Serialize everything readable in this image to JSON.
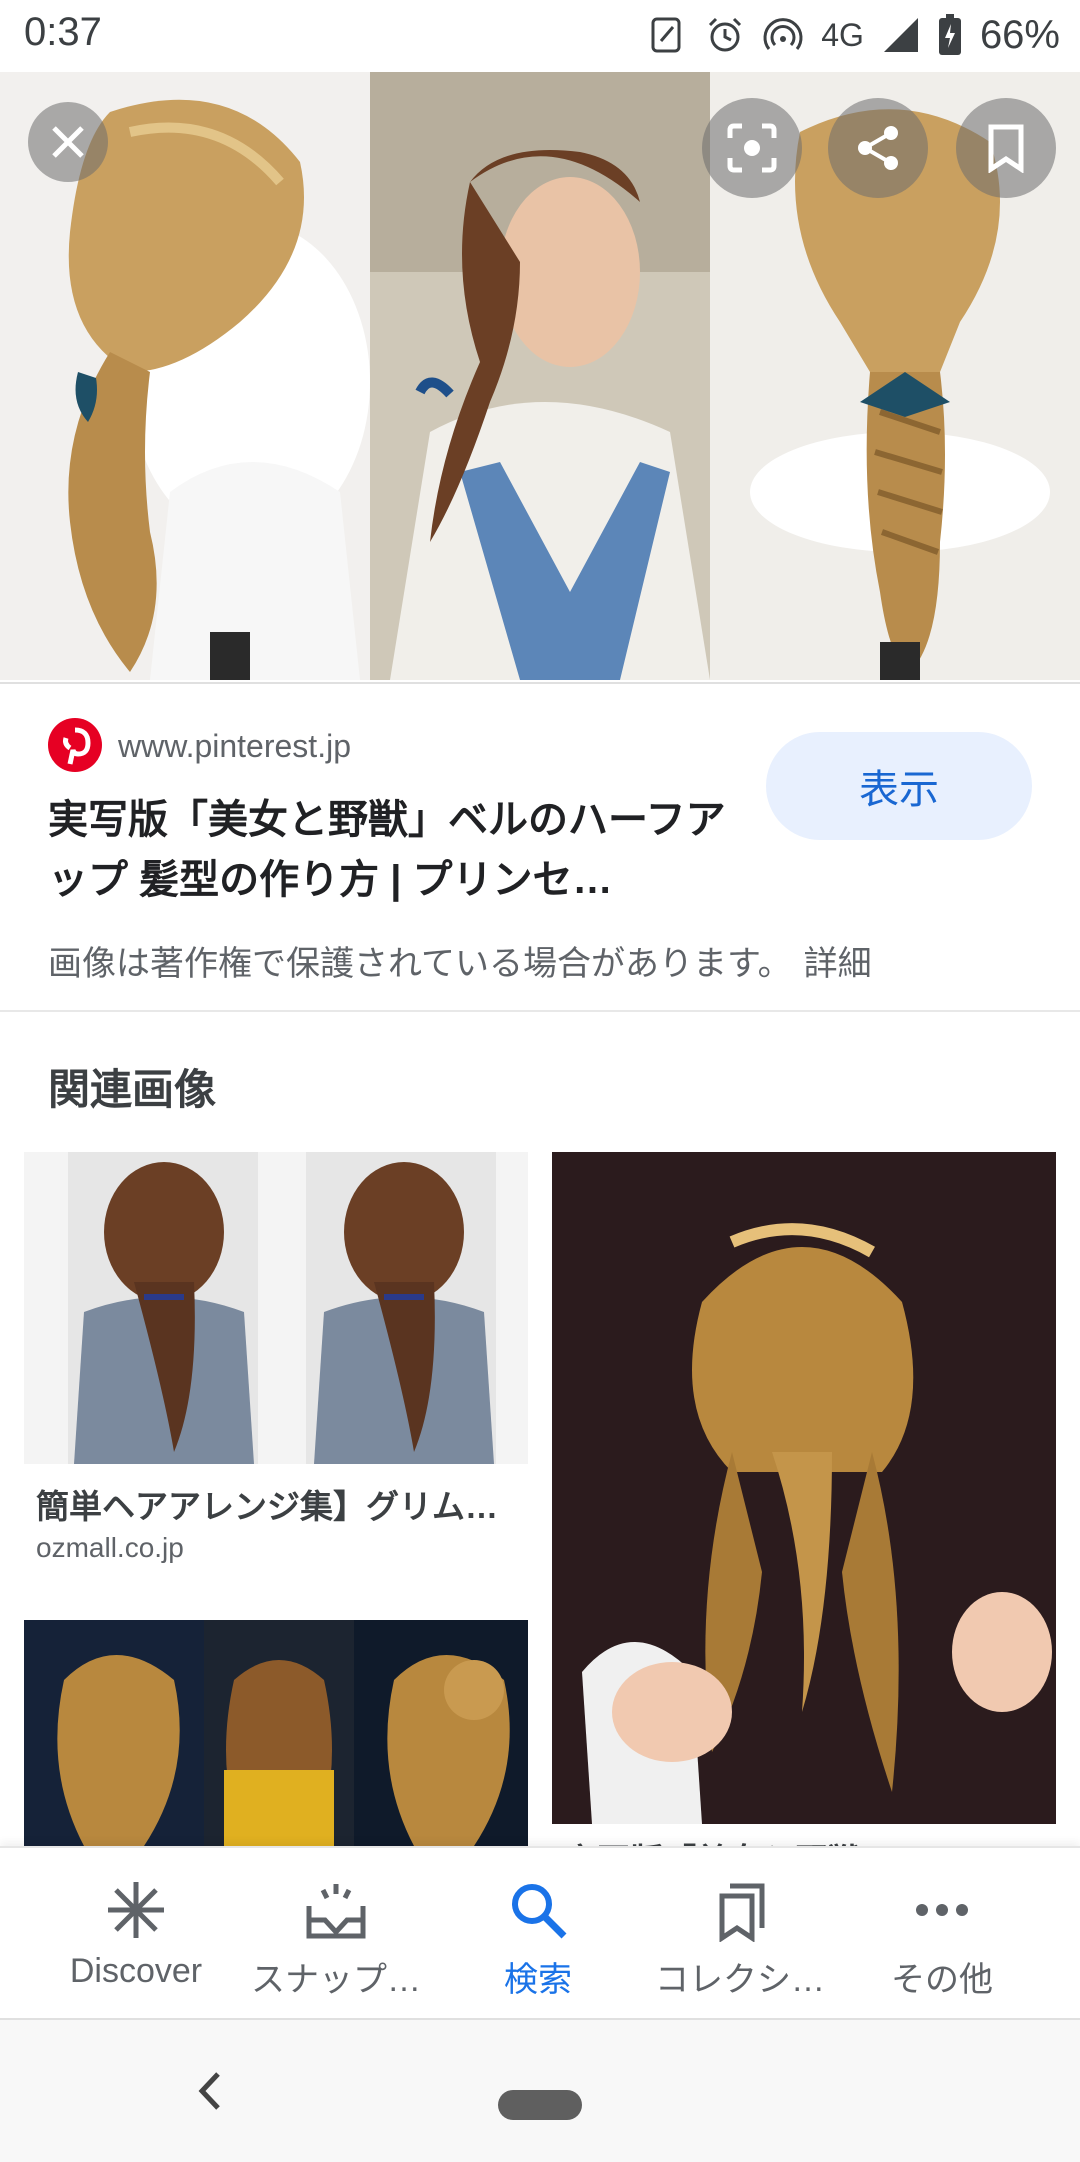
{
  "status_bar": {
    "time": "0:37",
    "network": "4G",
    "battery": "66%"
  },
  "result": {
    "domain": "www.pinterest.jp",
    "title": "実写版「美女と野獣」ベルのハーフアップ 髪型の作り方 | プリンセ…",
    "view_button": "表示",
    "copyright_notice": "画像は著作権で保護されている場合があります。",
    "details_link": "詳細"
  },
  "related": {
    "heading": "関連画像",
    "cards": [
      {
        "title": "簡単ヘアアレンジ集】グリム…",
        "domain": "ozmall.co.jp"
      },
      {
        "title": "実写版「美女と野獣」ベ…"
      },
      {
        "title": ""
      }
    ]
  },
  "bottom_nav": {
    "items": [
      {
        "label": "Discover",
        "icon": "asterisk-icon"
      },
      {
        "label": "スナップ…",
        "icon": "snapshot-icon"
      },
      {
        "label": "検索",
        "icon": "search-icon",
        "active": true
      },
      {
        "label": "コレクシ…",
        "icon": "collections-icon"
      },
      {
        "label": "その他",
        "icon": "more-dots-icon"
      }
    ]
  },
  "colors": {
    "accent": "#1a73e8",
    "pinterest": "#e60023",
    "view_button_bg": "#e8f0fe"
  }
}
